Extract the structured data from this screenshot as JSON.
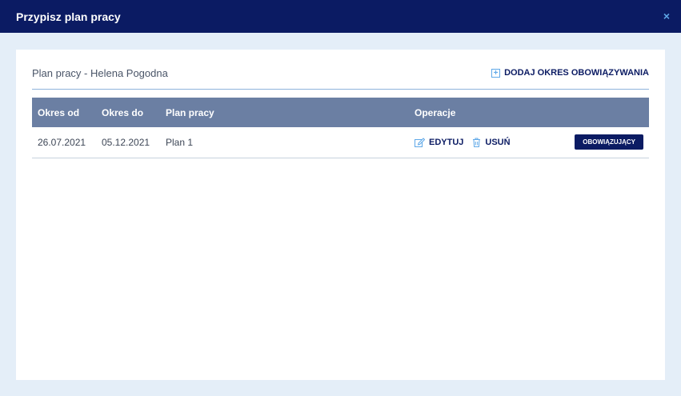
{
  "dialog": {
    "title": "Przypisz plan pracy",
    "close_symbol": "×"
  },
  "panel": {
    "title": "Plan pracy - Helena Pogodna",
    "add_button_label": "DODAJ OKRES OBOWIĄZYWANIA",
    "add_icon_symbol": "+"
  },
  "table": {
    "headers": [
      "Okres od",
      "Okres do",
      "Plan pracy",
      "Operacje"
    ],
    "rows": [
      {
        "from": "26.07.2021",
        "to": "05.12.2021",
        "plan": "Plan 1",
        "edit_label": "EDYTUJ",
        "delete_label": "USUŃ",
        "status": "OBOWIĄZUJĄCY"
      }
    ]
  },
  "colors": {
    "header_bg": "#0b1b63",
    "accent": "#5fa8e8",
    "table_header_bg": "#6b7fa3",
    "page_bg": "#e4eef8"
  },
  "icons": {
    "close": "close-icon",
    "add": "plus-square-icon",
    "edit": "edit-icon",
    "delete": "trash-icon"
  }
}
